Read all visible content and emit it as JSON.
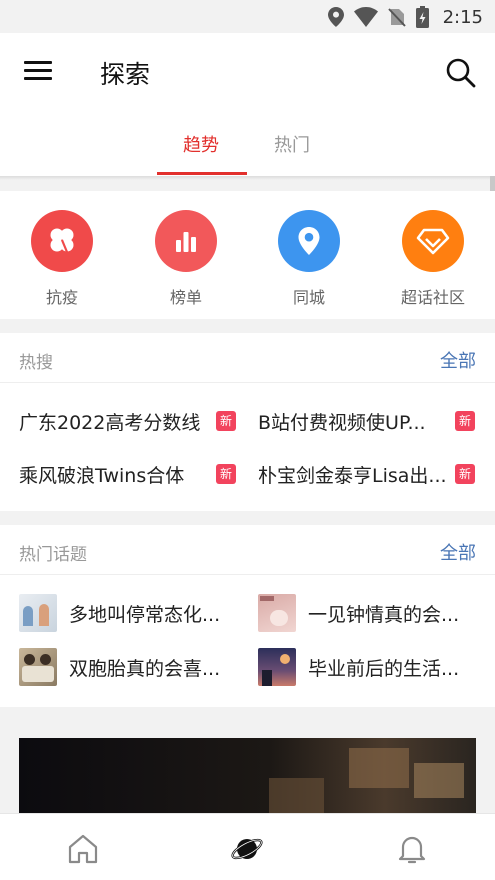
{
  "status_bar": {
    "time": "2:15",
    "icons": [
      "location-icon",
      "wifi-icon",
      "no-sim-icon",
      "battery-charging-icon"
    ]
  },
  "app_bar": {
    "title": "探索",
    "icons": [
      "menu-icon",
      "search-icon"
    ]
  },
  "tabs": [
    {
      "label": "趋势",
      "active": true
    },
    {
      "label": "热门",
      "active": false
    }
  ],
  "categories": [
    {
      "label": "抗疫",
      "icon": "clover-icon",
      "color": "#f04a4a"
    },
    {
      "label": "榜单",
      "icon": "bar-chart-icon",
      "color": "#f2585a"
    },
    {
      "label": "同城",
      "icon": "location-pin-icon",
      "color": "#3d95ef"
    },
    {
      "label": "超话社区",
      "icon": "diamond-icon",
      "color": "#ff7f10"
    }
  ],
  "hot_search": {
    "title": "热搜",
    "more": "全部",
    "badge": "新",
    "items": [
      {
        "text": "广东2022高考分数线"
      },
      {
        "text": "B站付费视频使UP..."
      },
      {
        "text": "乘风破浪Twins合体"
      },
      {
        "text": "朴宝剑金泰亨Lisa出..."
      }
    ]
  },
  "hot_topics": {
    "title": "热门话题",
    "more": "全部",
    "items": [
      {
        "text": "多地叫停常态化..."
      },
      {
        "text": "一见钟情真的会..."
      },
      {
        "text": "双胞胎真的会喜..."
      },
      {
        "text": "毕业前后的生活..."
      }
    ]
  },
  "bottom_nav": [
    {
      "name": "home",
      "icon": "home-icon",
      "active": false
    },
    {
      "name": "discover",
      "icon": "planet-icon",
      "active": true
    },
    {
      "name": "notifications",
      "icon": "bell-icon",
      "active": false
    }
  ],
  "colors": {
    "accent": "#e2302d",
    "link": "#4a76b5",
    "badge": "#f2435d"
  }
}
